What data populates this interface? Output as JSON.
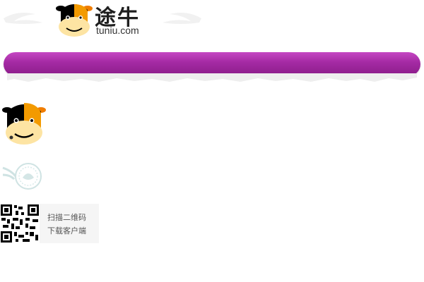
{
  "brand": {
    "name_cn": "途牛",
    "domain": "tuniu.com",
    "banner_color": "#a62ba5"
  },
  "qr": {
    "line1": "扫描二维码",
    "line2": "下载客户端"
  },
  "icons": [
    "tuniu-cow-logo-icon",
    "mascot-cow-icon",
    "stamp-seal-icon",
    "qr-code-icon"
  ]
}
